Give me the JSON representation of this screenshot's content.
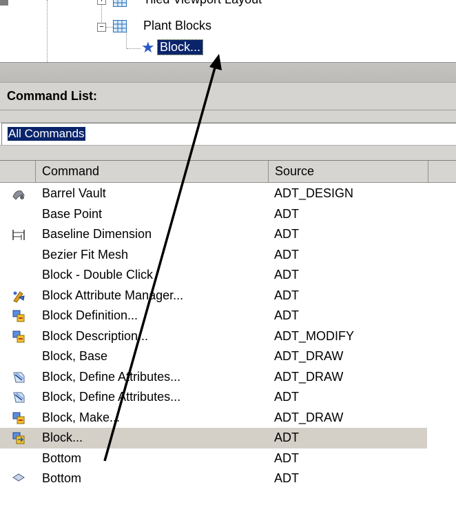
{
  "tree": {
    "items": [
      {
        "label": "Tiled Viewport Layout",
        "expander": "+"
      },
      {
        "label": "Plant Blocks",
        "expander": "−"
      },
      {
        "label": "Block...",
        "selected": true
      }
    ]
  },
  "command_list": {
    "title": "Command List:",
    "filter_value": "All Commands",
    "columns": [
      "Command",
      "Source"
    ],
    "rows": [
      {
        "command": "Barrel Vault",
        "source": "ADT_DESIGN",
        "icon": "barrel-vault-icon"
      },
      {
        "command": "Base Point",
        "source": "ADT",
        "icon": ""
      },
      {
        "command": "Baseline Dimension",
        "source": "ADT",
        "icon": "baseline-dimension-icon"
      },
      {
        "command": "Bezier Fit Mesh",
        "source": "ADT",
        "icon": ""
      },
      {
        "command": "Block - Double Click",
        "source": "ADT",
        "icon": ""
      },
      {
        "command": "Block Attribute Manager...",
        "source": "ADT",
        "icon": "attribute-manager-icon"
      },
      {
        "command": "Block Definition...",
        "source": "ADT",
        "icon": "block-icon"
      },
      {
        "command": "Block Description...",
        "source": "ADT_MODIFY",
        "icon": "block-icon"
      },
      {
        "command": "Block, Base",
        "source": "ADT_DRAW",
        "icon": ""
      },
      {
        "command": "Block, Define Attributes...",
        "source": "ADT_DRAW",
        "icon": "define-attributes-icon"
      },
      {
        "command": "Block, Define Attributes...",
        "source": "ADT",
        "icon": "define-attributes-icon"
      },
      {
        "command": "Block, Make...",
        "source": "ADT_DRAW",
        "icon": "block-icon"
      },
      {
        "command": "Block...",
        "source": "ADT",
        "icon": "block-insert-icon",
        "selected": true
      },
      {
        "command": "Bottom",
        "source": "ADT",
        "icon": ""
      },
      {
        "command": "Bottom",
        "source": "ADT",
        "icon": "bottom-view-icon"
      }
    ]
  },
  "colors": {
    "selection": "#0a246a",
    "panel": "#d5d4d1",
    "row_highlight": "#d4d0c8",
    "arrow": "#000000"
  }
}
